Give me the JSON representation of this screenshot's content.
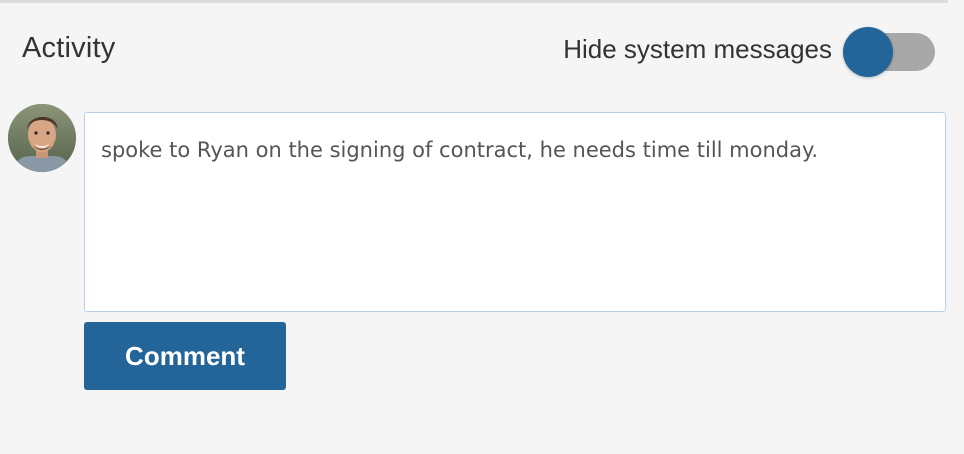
{
  "activity": {
    "title": "Activity",
    "hide_system_messages_label": "Hide system messages",
    "hide_system_messages_enabled": true
  },
  "comment": {
    "text": "spoke to Ryan on the signing of contract, he needs time till monday.",
    "button_label": "Comment"
  },
  "colors": {
    "accent": "#236499",
    "toggle_track": "#a8a8a8",
    "background": "#f5f5f5",
    "input_border": "#b9d2ea"
  },
  "icons": {
    "avatar": "user-avatar"
  }
}
